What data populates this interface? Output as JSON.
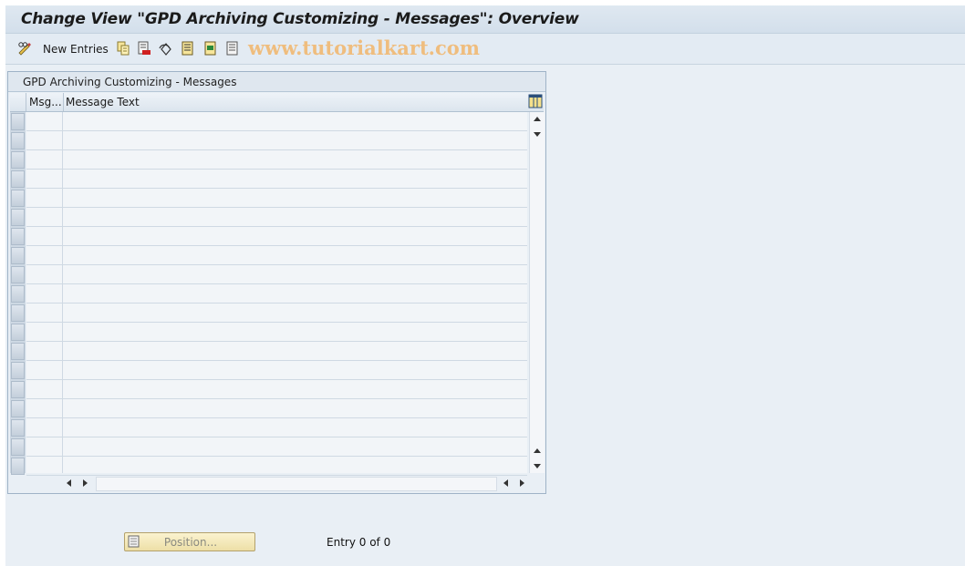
{
  "window": {
    "title": "Change View \"GPD Archiving Customizing - Messages\": Overview"
  },
  "toolbar": {
    "new_entries_label": "New Entries",
    "icons": [
      "display-change-icon",
      "copy-as-icon",
      "delete-icon",
      "undo-change-icon",
      "select-all-icon",
      "select-block-icon",
      "deselect-all-icon"
    ]
  },
  "watermark": "www.tutorialkart.com",
  "table": {
    "title": "GPD Archiving Customizing - Messages",
    "columns": [
      "Msg...",
      "Message Text"
    ],
    "rows": []
  },
  "footer": {
    "position_button_label": "Position...",
    "entry_text": "Entry 0 of 0"
  },
  "colors": {
    "background": "#e9eff5",
    "title_bar": "#d3dfeb",
    "watermark": "#f2b66a",
    "button_yellow": "#f5ebbf"
  }
}
